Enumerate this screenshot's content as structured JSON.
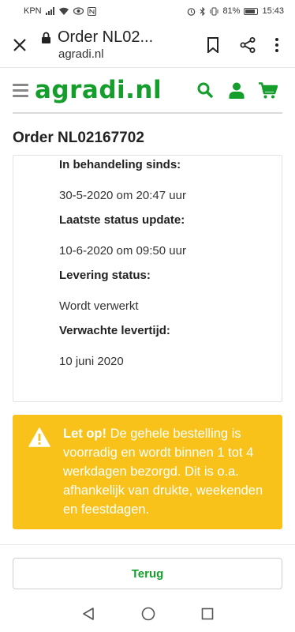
{
  "status_bar": {
    "carrier": "KPN",
    "battery": "81%",
    "time": "15:43"
  },
  "browser": {
    "title": "Order NL02...",
    "url": "agradi.nl"
  },
  "site": {
    "logo": "agradi.nl",
    "brand_color": "#159e2b"
  },
  "order": {
    "title": "Order NL02167702",
    "fields": [
      {
        "label": "In behandeling sinds:",
        "value": "30-5-2020 om 20:47 uur"
      },
      {
        "label": "Laatste status update:",
        "value": "10-6-2020 om 09:50 uur"
      },
      {
        "label": "Levering status:",
        "value": "Wordt verwerkt"
      },
      {
        "label": "Verwachte levertijd:",
        "value": "10 juni 2020"
      }
    ]
  },
  "alert": {
    "bold": "Let op!",
    "text": " De gehele bestelling is voorradig en wordt binnen 1 tot 4 werkdagen bezorgd. Dit is o.a. afhankelijk van drukte, weekenden en feestdagen.",
    "color": "#f8c21b"
  },
  "back_button": "Terug"
}
